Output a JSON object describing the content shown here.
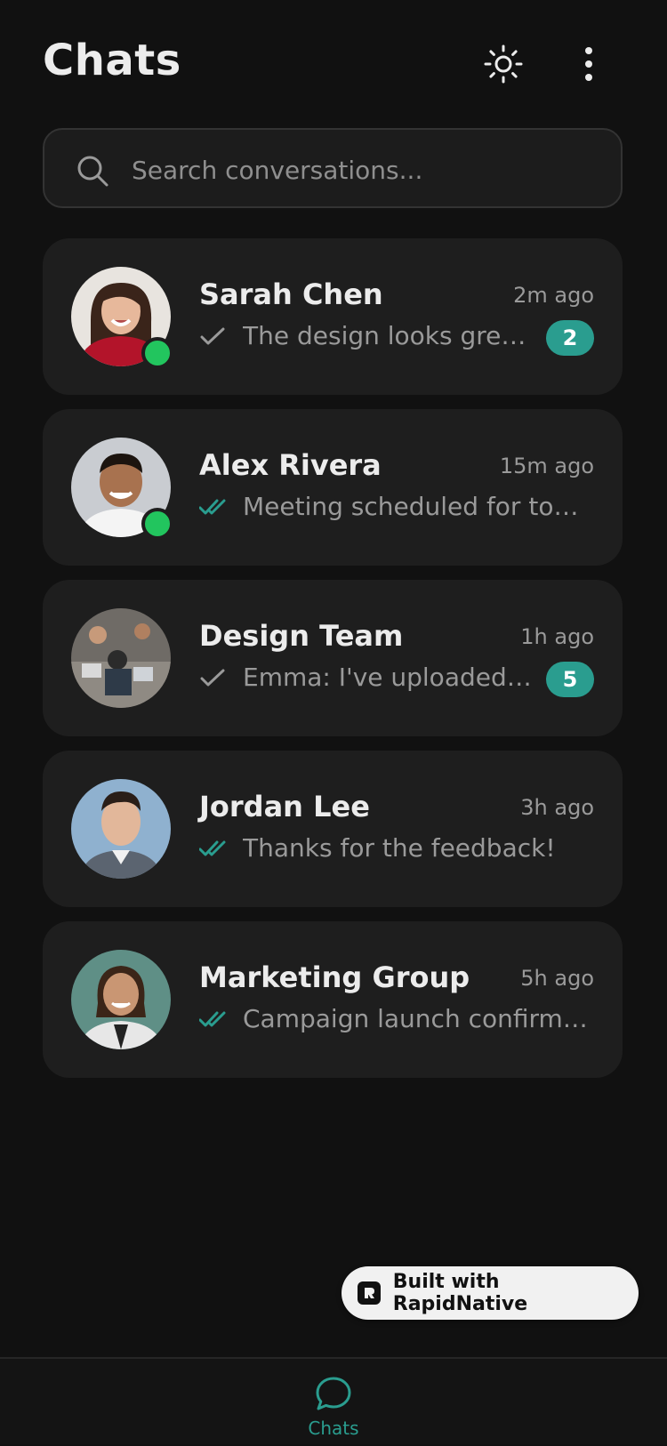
{
  "header": {
    "title": "Chats",
    "theme_icon": "sun-icon",
    "menu_icon": "more-vertical-icon"
  },
  "search": {
    "placeholder": "Search conversations...",
    "value": "",
    "icon": "search-icon"
  },
  "chats": [
    {
      "name": "Sarah Chen",
      "time": "2m ago",
      "message": "The design looks great! L...",
      "status": "sent",
      "unread": "2",
      "online": true
    },
    {
      "name": "Alex Rivera",
      "time": "15m ago",
      "message": "Meeting scheduled for tomo...",
      "status": "read",
      "unread": "",
      "online": true
    },
    {
      "name": "Design Team",
      "time": "1h ago",
      "message": "Emma: I've uploaded the...",
      "status": "sent",
      "unread": "5",
      "online": false
    },
    {
      "name": "Jordan Lee",
      "time": "3h ago",
      "message": "Thanks for the feedback!",
      "status": "read",
      "unread": "",
      "online": false
    },
    {
      "name": "Marketing Group",
      "time": "5h ago",
      "message": "Campaign launch confirmed ...",
      "status": "read",
      "unread": "",
      "online": false
    }
  ],
  "floating_badge": {
    "label": "Built with RapidNative"
  },
  "bottom_nav": {
    "items": [
      {
        "label": "Chats",
        "icon": "chat-bubble-icon",
        "active": true
      }
    ]
  },
  "colors": {
    "background": "#111111",
    "card": "#1e1e1e",
    "accent": "#2a9d8f",
    "online": "#22c55e",
    "text_primary": "#ececec",
    "text_secondary": "#9a9a9a"
  }
}
